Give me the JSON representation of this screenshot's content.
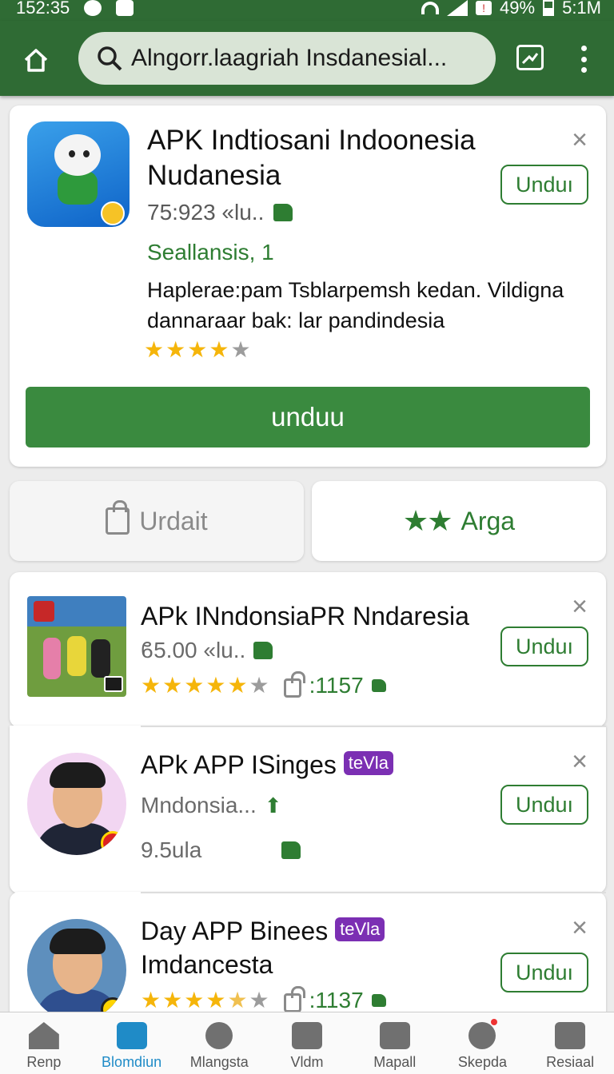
{
  "status_bar": {
    "time_left": "152:35",
    "battery": "49%",
    "time_right": "5:1M"
  },
  "search": {
    "query": "Alngorr.laagriah Insdanesial..."
  },
  "featured": {
    "title": "APK Indtiosani Indoonesia Nudanesia",
    "meta": "75:923 «lu..",
    "developer": "Seallansis, 1",
    "description": "Haplerae:pam Tsblarpemsh kedan. Vildigna dannaraar bak: lar pandindesia",
    "rating_stars": 4,
    "install_small": "Unduı",
    "install_big": "unduu"
  },
  "actions": {
    "left_label": "Urdait",
    "right_label": "Arga"
  },
  "apps": [
    {
      "name": "APk INndonsiaPR Nndaresia",
      "price": "ϐ5.00 «lu..",
      "rating_stars": 5,
      "downloads": ":1157",
      "install": "Unduı"
    },
    {
      "name": "APk APP ISinges",
      "badge": "teVla",
      "subtitle": "Mndonsia...",
      "size": "9.5ula",
      "install": "Unduı"
    },
    {
      "name": "Day APP Binees",
      "badge": "teVla",
      "subtitle": "Imdancesta",
      "rating_stars": 4.5,
      "downloads": ":1137",
      "install": "Unduı"
    }
  ],
  "bottom_nav": [
    {
      "label": "Renp"
    },
    {
      "label": "Blomdiun"
    },
    {
      "label": "Mlangsta"
    },
    {
      "label": "Vldm"
    },
    {
      "label": "Mapall"
    },
    {
      "label": "Skepda"
    },
    {
      "label": "Resiaal"
    }
  ],
  "colors": {
    "primary": "#2f6b34",
    "accent": "#2e7d32",
    "active_nav": "#1f8bc7",
    "star": "#f5b50a",
    "badge": "#7b2fb3"
  }
}
